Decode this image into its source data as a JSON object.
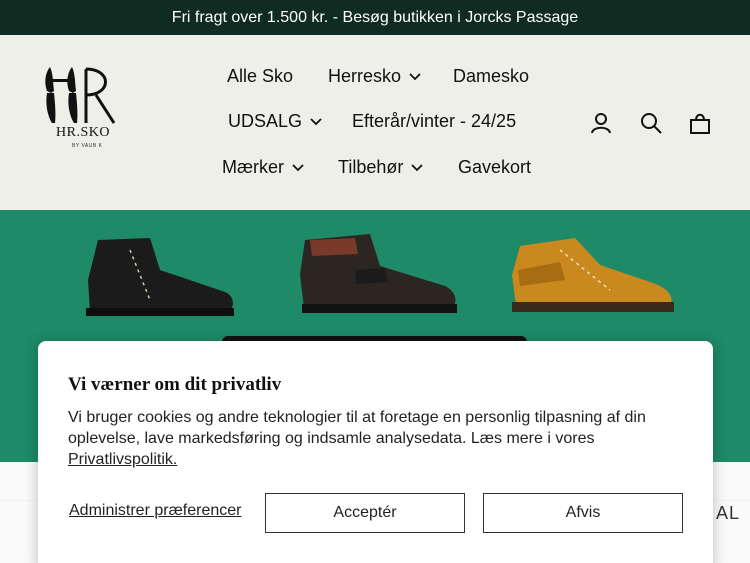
{
  "announcement": "Fri fragt over 1.500 kr. - Besøg butikken i Jorcks Passage",
  "logo": {
    "text": "HR.SKO",
    "sub": "BY VAUB K"
  },
  "nav": {
    "row1": [
      {
        "label": "Alle Sko",
        "dropdown": false
      },
      {
        "label": "Herresko",
        "dropdown": true
      },
      {
        "label": "Damesko",
        "dropdown": false
      }
    ],
    "row2": [
      {
        "label": "UDSALG",
        "dropdown": true
      },
      {
        "label": "Efterår/vinter - 24/25",
        "dropdown": false
      }
    ],
    "row3": [
      {
        "label": "Mærker",
        "dropdown": true
      },
      {
        "label": "Tilbehør",
        "dropdown": true
      },
      {
        "label": "Gavekort",
        "dropdown": false
      }
    ]
  },
  "icons": [
    "account-icon",
    "search-icon",
    "cart-icon"
  ],
  "hero": {
    "background_color": "#1e8a68"
  },
  "below_text": "AL",
  "cookie": {
    "title": "Vi værner om dit privatliv",
    "body": "Vi bruger cookies og andre teknologier til at foretage en personlig tilpasning af din oplevelse, lave markedsføring og indsamle analysedata. Læs mere i vores",
    "policy_link": "Privatlivspolitik.",
    "manage": "Administrer præferencer",
    "accept": "Acceptér",
    "decline": "Afvis"
  }
}
